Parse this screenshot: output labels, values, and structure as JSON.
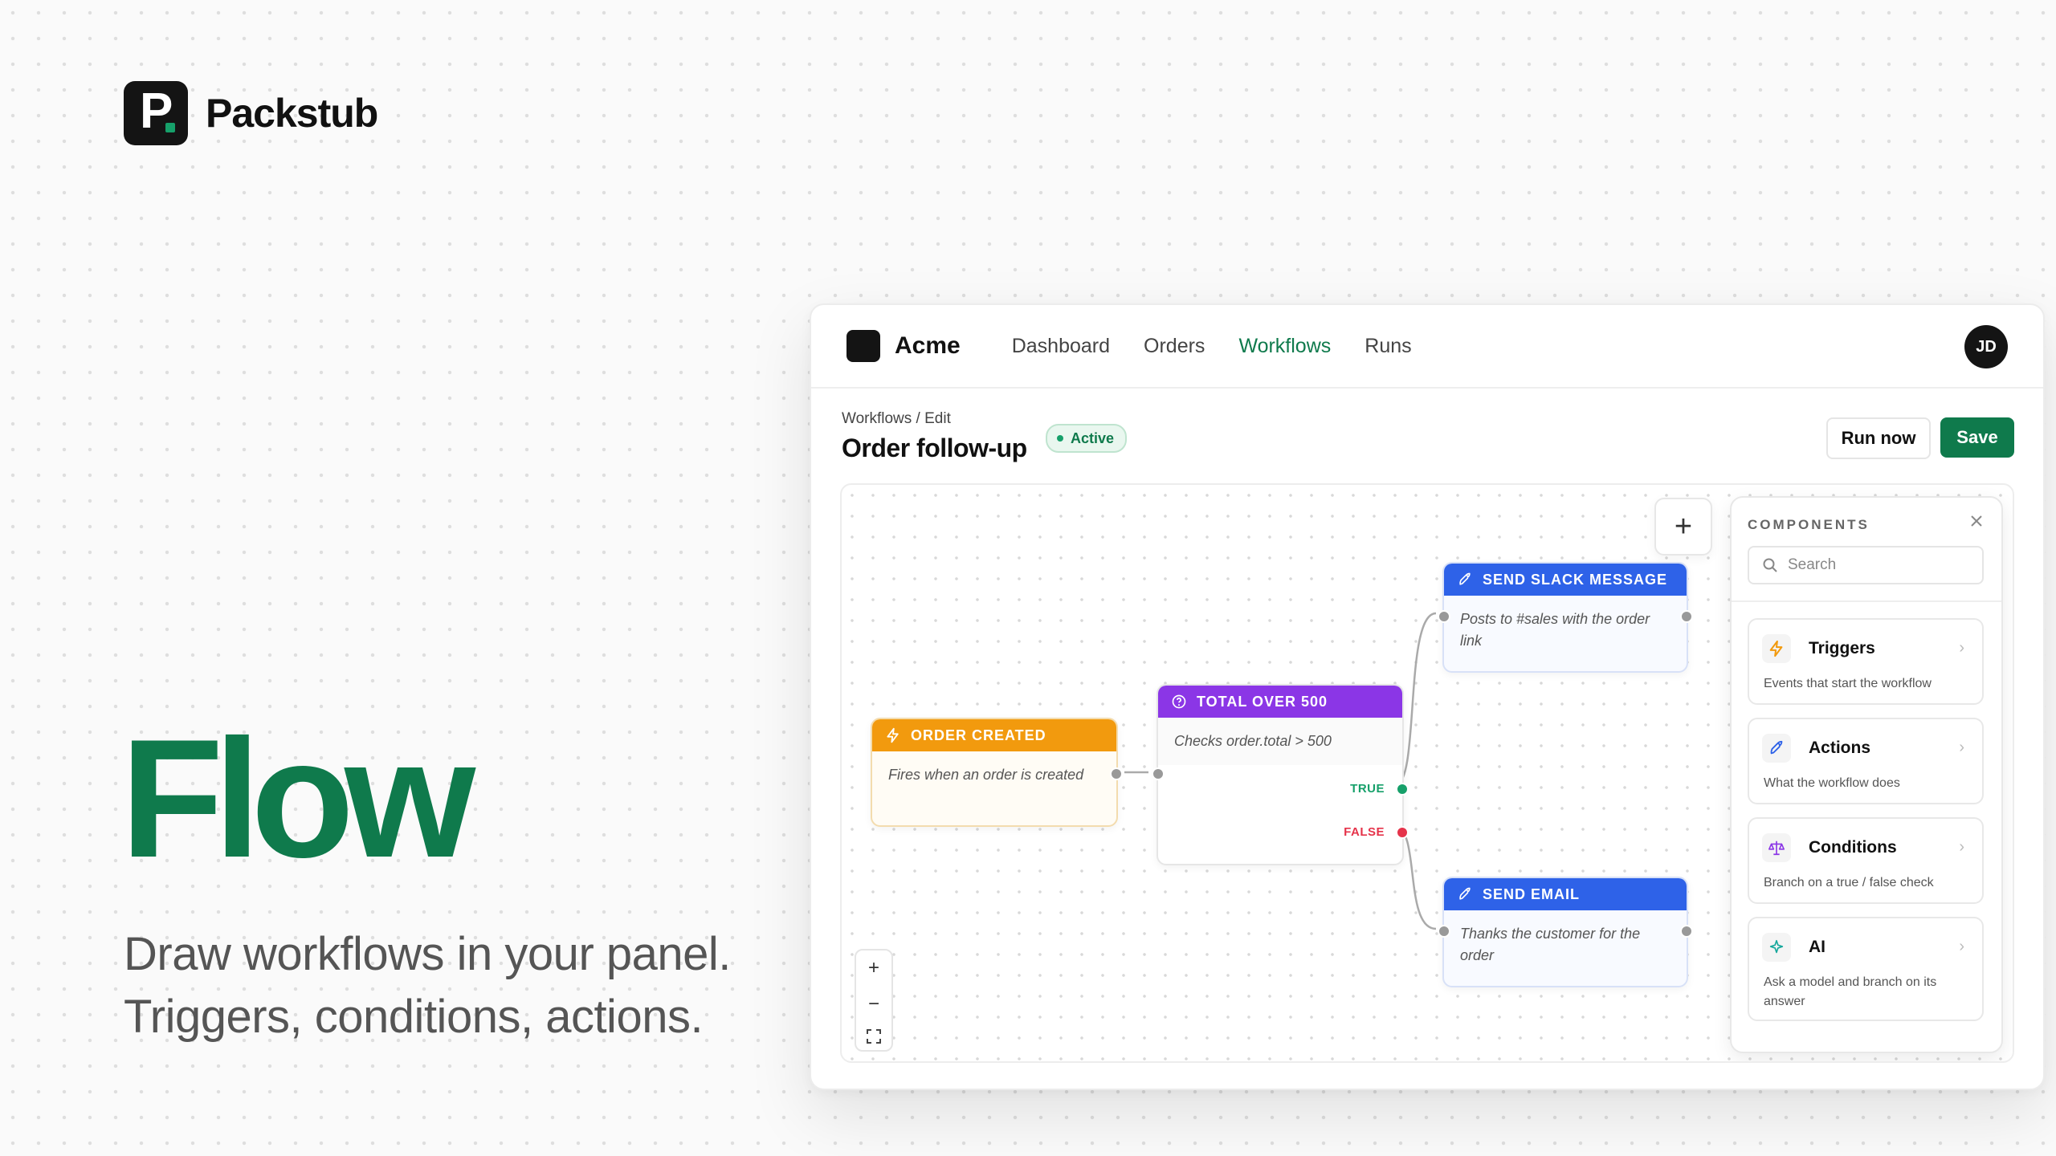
{
  "brand": {
    "name": "Packstub",
    "logo_letter": "P"
  },
  "hero": {
    "title": "Flow",
    "subtitle_line1": "Draw workflows in your panel.",
    "subtitle_line2": "Triggers, conditions, actions."
  },
  "app": {
    "name": "Acme",
    "nav": [
      "Dashboard",
      "Orders",
      "Workflows",
      "Runs"
    ],
    "active_nav": "Workflows",
    "avatar_initials": "JD"
  },
  "page": {
    "breadcrumb": "Workflows / Edit",
    "title": "Order follow-up",
    "status": "Active",
    "run_button": "Run now",
    "save_button": "Save"
  },
  "canvas": {
    "nodes": {
      "order_created": {
        "title": "ORDER CREATED",
        "desc": "Fires when an order is created",
        "color": "#f29a0e",
        "icon": "bolt-icon"
      },
      "total_over": {
        "title": "TOTAL OVER 500",
        "desc": "Checks order.total > 500",
        "color": "#8b36e6",
        "icon": "question-icon",
        "true_label": "TRUE",
        "false_label": "FALSE"
      },
      "slack": {
        "title": "SEND SLACK MESSAGE",
        "desc": "Posts to #sales with the order link",
        "color": "#2e62e8",
        "icon": "rocket-icon"
      },
      "email": {
        "title": "SEND EMAIL",
        "desc": "Thanks the customer for the order",
        "color": "#2e62e8",
        "icon": "rocket-icon"
      }
    },
    "zoom": {
      "in": "+",
      "out": "−"
    },
    "add": "+"
  },
  "components_panel": {
    "title": "COMPONENTS",
    "search_placeholder": "Search",
    "items": [
      {
        "name": "Triggers",
        "desc": "Events that start the workflow",
        "icon": "bolt-icon",
        "color": "#f29a0e"
      },
      {
        "name": "Actions",
        "desc": "What the workflow does",
        "icon": "rocket-icon",
        "color": "#2e62e8"
      },
      {
        "name": "Conditions",
        "desc": "Branch on a true / false check",
        "icon": "scale-icon",
        "color": "#8b36e6"
      },
      {
        "name": "AI",
        "desc": "Ask a model and branch on its answer",
        "icon": "sparkle-icon",
        "color": "#14a79b"
      }
    ]
  },
  "colors": {
    "accent": "#0f7a4c",
    "true": "#16a06a",
    "false": "#e5334a"
  }
}
